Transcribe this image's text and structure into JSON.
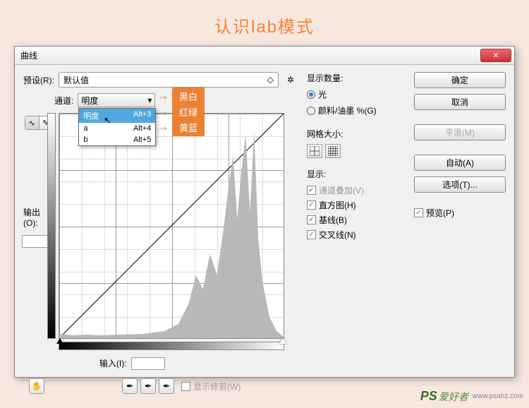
{
  "page_title": "认识lab模式",
  "dialog": {
    "title": "曲线",
    "close_x": "✕",
    "preset_label": "预设(R):",
    "preset_value": "默认值",
    "channel_label": "通道:",
    "channel_value": "明度",
    "dropdown": [
      {
        "name": "明度",
        "shortcut": "Alt+3"
      },
      {
        "name": "a",
        "shortcut": "Alt+4"
      },
      {
        "name": "b",
        "shortcut": "Alt+5"
      }
    ],
    "output_label": "输出(O):",
    "input_label": "输入(I):",
    "show_clip_label": "显示修剪(W)",
    "display_qty_label": "显示数量:",
    "radio_light": "光",
    "radio_pigment": "颜料/油墨 %(G)",
    "grid_size_label": "网格大小:",
    "show_label": "显示:",
    "show_items": {
      "overlay": "通道叠加(V)",
      "histogram": "直方图(H)",
      "baseline": "基线(B)",
      "intersect": "交叉线(N)"
    },
    "buttons": {
      "ok": "确定",
      "cancel": "取消",
      "smooth": "平滑(M)",
      "auto": "自动(A)",
      "options": "选项(T)..."
    },
    "preview_label": "预览(P)"
  },
  "tags": {
    "bw": "黑白",
    "rg": "红绿",
    "yb": "黄蓝"
  },
  "watermark": {
    "brand": "PS",
    "text": "爱好者",
    "url": "www.psahz.com"
  }
}
